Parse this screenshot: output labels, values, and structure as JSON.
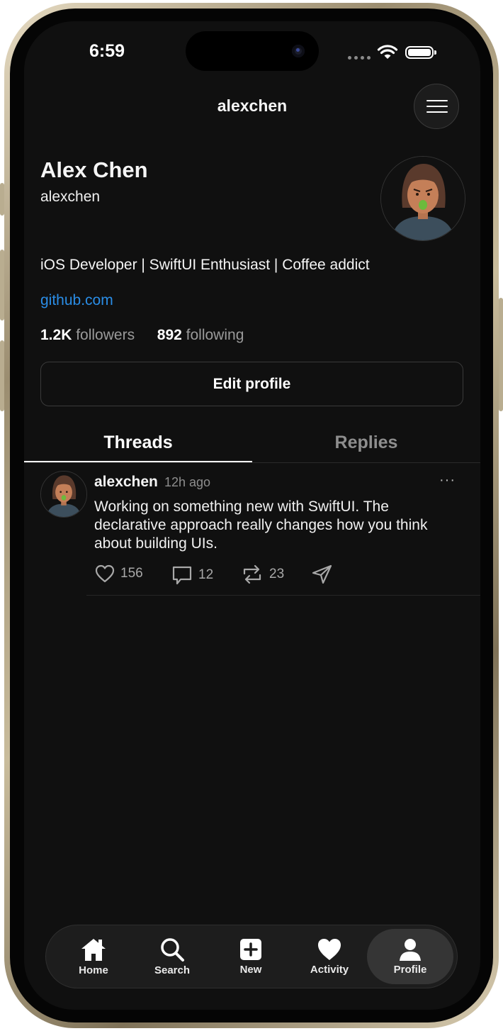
{
  "status_bar": {
    "time": "6:59"
  },
  "nav": {
    "title": "alexchen",
    "menu_icon": "hamburger-menu-icon"
  },
  "profile": {
    "name": "Alex Chen",
    "handle": "alexchen",
    "bio": "iOS Developer | SwiftUI Enthusiast | Coffee addict",
    "link": "github.com",
    "followers_count": "1.2K",
    "followers_label": "followers",
    "following_count": "892",
    "following_label": "following",
    "edit_label": "Edit profile"
  },
  "tabs": [
    {
      "label": "Threads",
      "active": true
    },
    {
      "label": "Replies",
      "active": false
    }
  ],
  "posts": [
    {
      "user": "alexchen",
      "time": "12h ago",
      "more": "···",
      "text": "Working on something new with SwiftUI. The declarative approach really changes how you think about building UIs.",
      "likes": "156",
      "comments": "12",
      "reposts": "23"
    }
  ],
  "tab_bar": [
    {
      "label": "Home",
      "icon": "home-icon"
    },
    {
      "label": "Search",
      "icon": "search-icon"
    },
    {
      "label": "New",
      "icon": "plus-square-icon"
    },
    {
      "label": "Activity",
      "icon": "heart-icon"
    },
    {
      "label": "Profile",
      "icon": "person-icon",
      "active": true
    }
  ],
  "colors": {
    "background": "#101010",
    "link": "#2a8de6",
    "muted": "#8e8e8e"
  }
}
